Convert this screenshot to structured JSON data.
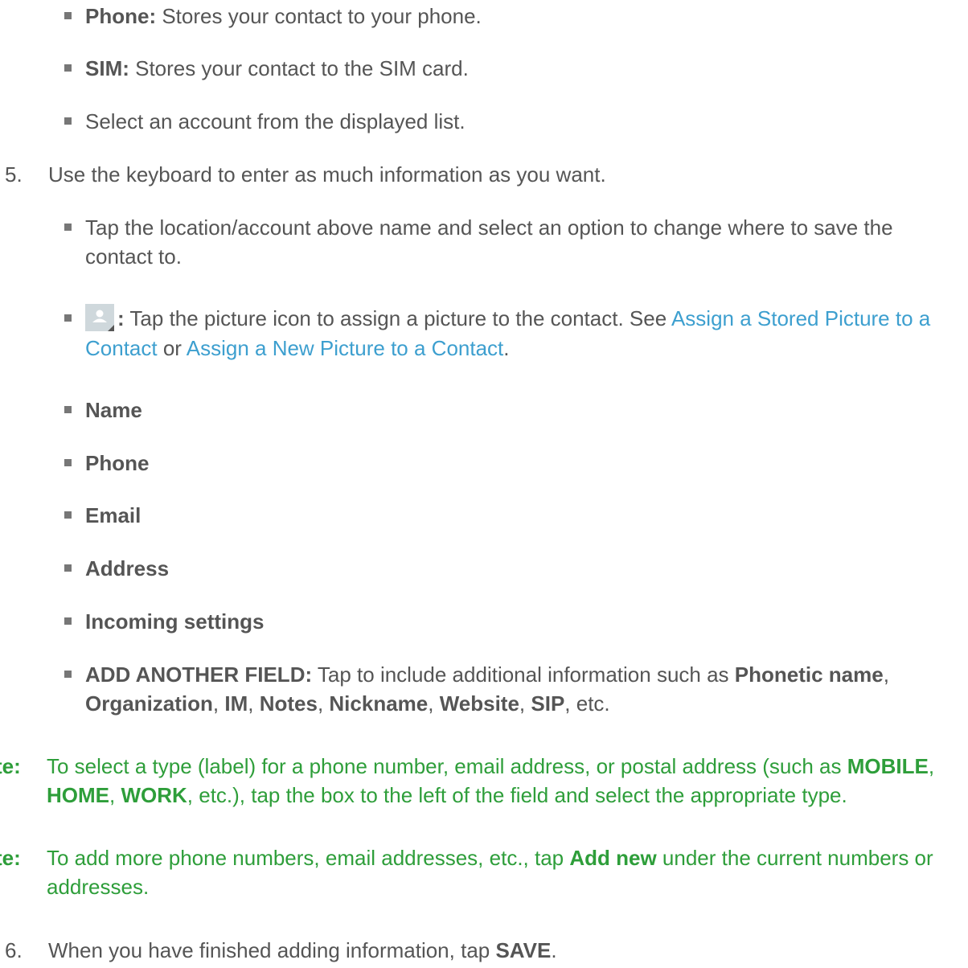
{
  "bullets_top": [
    {
      "bold": "Phone:",
      "text": " Stores your contact to your phone."
    },
    {
      "bold": "SIM:",
      "text": " Stores your contact to the SIM card."
    },
    {
      "bold": "",
      "text": "Select an account from the displayed list."
    }
  ],
  "step5": {
    "number": "5.",
    "text": "Use the keyboard to enter as much information as you want.",
    "location_bullet": "Tap the location/account above name and select an option to change where to save the contact to.",
    "picture_bullet": {
      "icon": "contact-picture-icon",
      "colon": ":",
      "text": " Tap the picture icon to assign a picture to the contact. See ",
      "link1": "Assign a Stored Picture to a Contact",
      "or": " or ",
      "link2": "Assign a New Picture to a Contact",
      "end": "."
    },
    "fields": [
      "Name",
      "Phone",
      "Email",
      "Address",
      "Incoming settings"
    ],
    "add_field": {
      "bold": "ADD ANOTHER FIELD:",
      "text": " Tap to include additional information such as ",
      "items": [
        "Phonetic name",
        "Organization",
        "IM",
        "Notes",
        "Nickname",
        "Website",
        "SIP"
      ],
      "sep": ", ",
      "end": ", etc."
    }
  },
  "note1": {
    "label": "te:",
    "a": "To select a type (label) for a phone number, email address, or postal address (such as ",
    "b1": "MOBILE",
    "s1": ", ",
    "b2": "HOME",
    "s2": ", ",
    "b3": "WORK",
    "c": ", etc.), tap the box to the left of the field and select the appropriate type."
  },
  "note2": {
    "label": "te:",
    "a": "To add more phone numbers, email addresses, etc., tap ",
    "b": "Add new",
    "c": " under the current numbers or addresses."
  },
  "step6": {
    "number": "6.",
    "text": "When you have finished adding information, tap ",
    "bold": "SAVE",
    "end": "."
  },
  "colors": {
    "text": "#555555",
    "link": "#3d9fcf",
    "note": "#2e9e3a"
  }
}
